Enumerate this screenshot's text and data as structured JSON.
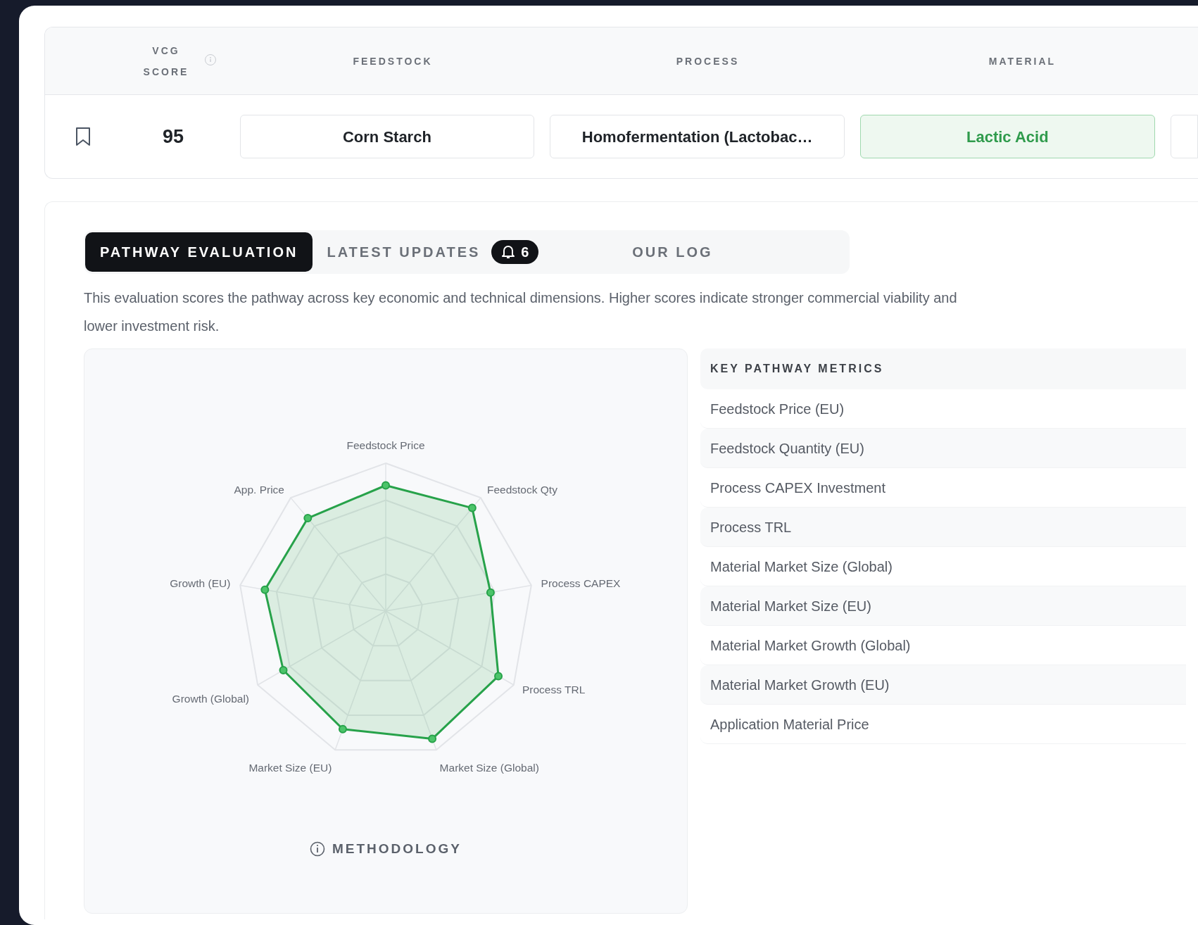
{
  "table": {
    "columns": [
      {
        "kind": "info",
        "label": "VCG SCORE"
      },
      {
        "kind": "plain",
        "label": "FEEDSTOCK"
      },
      {
        "kind": "plain",
        "label": "PROCESS"
      },
      {
        "kind": "plain",
        "label": "MATERIAL"
      }
    ],
    "rows": [
      {
        "bookmarked": false,
        "cells": [
          {
            "kind": "score",
            "text": "95"
          },
          {
            "kind": "value",
            "text": "Corn Starch",
            "selected": false
          },
          {
            "kind": "value",
            "text": "Homofermentation (Lactobac…",
            "selected": false
          },
          {
            "kind": "value",
            "text": "Lactic Acid",
            "selected": true
          }
        ]
      }
    ]
  },
  "tabs": [
    {
      "label": "PATHWAY EVALUATION",
      "selected": true
    },
    {
      "label": "LATEST UPDATES",
      "selected": false,
      "badge": "6"
    },
    {
      "label": "OUR LOG",
      "selected": false
    }
  ],
  "description": "This evaluation scores the pathway across key economic and technical dimensions. Higher scores indicate stronger commercial viability and lower investment risk.",
  "radar": {
    "axes": [
      "Feedstock Price",
      "App. Price",
      "Feedstock Qty",
      "Growth (EU)",
      "Process CAPEX",
      "Growth (Global)",
      "Process TRL",
      "Market Size (EU)",
      "Market Size (Global)"
    ],
    "methodology": "METHODOLOGY"
  },
  "metrics": {
    "title": "KEY PATHWAY METRICS",
    "items": [
      "Feedstock Price (EU)",
      "Feedstock Quantity (EU)",
      "Process CAPEX Investment",
      "Process TRL",
      "Material Market Size (Global)",
      "Material Market Size (EU)",
      "Material Market Growth (Global)",
      "Material Market Growth (EU)",
      "Application Material Price"
    ]
  }
}
